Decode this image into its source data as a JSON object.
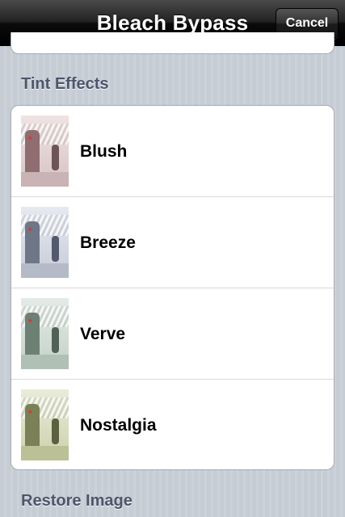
{
  "navbar": {
    "title": "Bleach Bypass",
    "cancel_label": "Cancel"
  },
  "sections": {
    "tint_effects": "Tint Effects",
    "restore_image": "Restore Image"
  },
  "effects": [
    {
      "label": "Blush",
      "tint": "#b48a8c"
    },
    {
      "label": "Breeze",
      "tint": "#8d96aa"
    },
    {
      "label": "Verve",
      "tint": "#8aa094"
    },
    {
      "label": "Nostalgia",
      "tint": "#9aa07a"
    }
  ],
  "colors": {
    "accent_header": "#4c566c",
    "background": "#c5ccd4",
    "navbar": "#000000"
  }
}
